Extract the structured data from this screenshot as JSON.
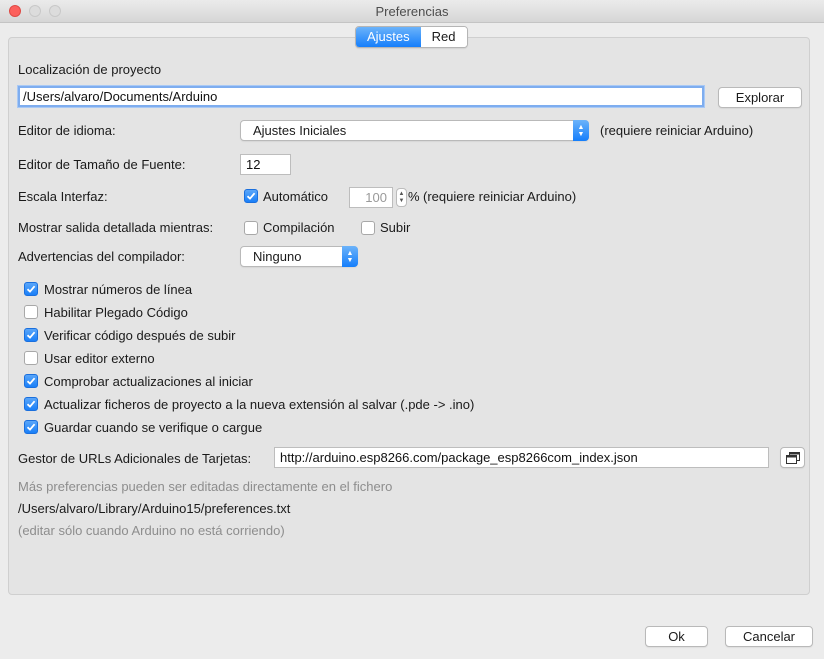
{
  "window": {
    "title": "Preferencias"
  },
  "tabs": [
    {
      "label": "Ajustes",
      "active": true
    },
    {
      "label": "Red",
      "active": false
    }
  ],
  "project_location": {
    "label": "Localización de proyecto",
    "value": "/Users/alvaro/Documents/Arduino",
    "browse_button": "Explorar"
  },
  "language": {
    "label": "Editor de idioma:",
    "value": "Ajustes Iniciales",
    "note": "(requiere reiniciar Arduino)"
  },
  "font_size": {
    "label": "Editor de Tamaño de Fuente:",
    "value": "12"
  },
  "scale": {
    "label": "Escala Interfaz:",
    "auto_label": "Automático",
    "auto_checked": true,
    "value": "100",
    "unit": "%",
    "note": "(requiere reiniciar Arduino)"
  },
  "verbose": {
    "label": "Mostrar salida detallada mientras:",
    "compile_label": "Compilación",
    "compile_checked": false,
    "upload_label": "Subir",
    "upload_checked": false
  },
  "warnings": {
    "label": "Advertencias del compilador:",
    "value": "Ninguno"
  },
  "options": [
    {
      "label": "Mostrar números de línea",
      "checked": true
    },
    {
      "label": "Habilitar Plegado Código",
      "checked": false
    },
    {
      "label": "Verificar código después de subir",
      "checked": true
    },
    {
      "label": "Usar editor externo",
      "checked": false
    },
    {
      "label": "Comprobar actualizaciones al iniciar",
      "checked": true
    },
    {
      "label": "Actualizar ficheros de proyecto a la nueva extensión al salvar (.pde -> .ino)",
      "checked": true
    },
    {
      "label": "Guardar cuando se verifique o cargue",
      "checked": true
    }
  ],
  "boards_url": {
    "label": "Gestor de URLs Adicionales de Tarjetas:",
    "value": "http://arduino.esp8266.com/package_esp8266com_index.json"
  },
  "footer": {
    "more_prefs": "Más preferencias pueden ser editadas directamente en el fichero",
    "prefs_path": "/Users/alvaro/Library/Arduino15/preferences.txt",
    "edit_note": "(editar sólo cuando Arduino no está corriendo)"
  },
  "buttons": {
    "ok": "Ok",
    "cancel": "Cancelar"
  },
  "colors": {
    "accent": "#157efb",
    "close": "#fc605c",
    "background": "#ececec",
    "panel": "#e4e4e4"
  }
}
